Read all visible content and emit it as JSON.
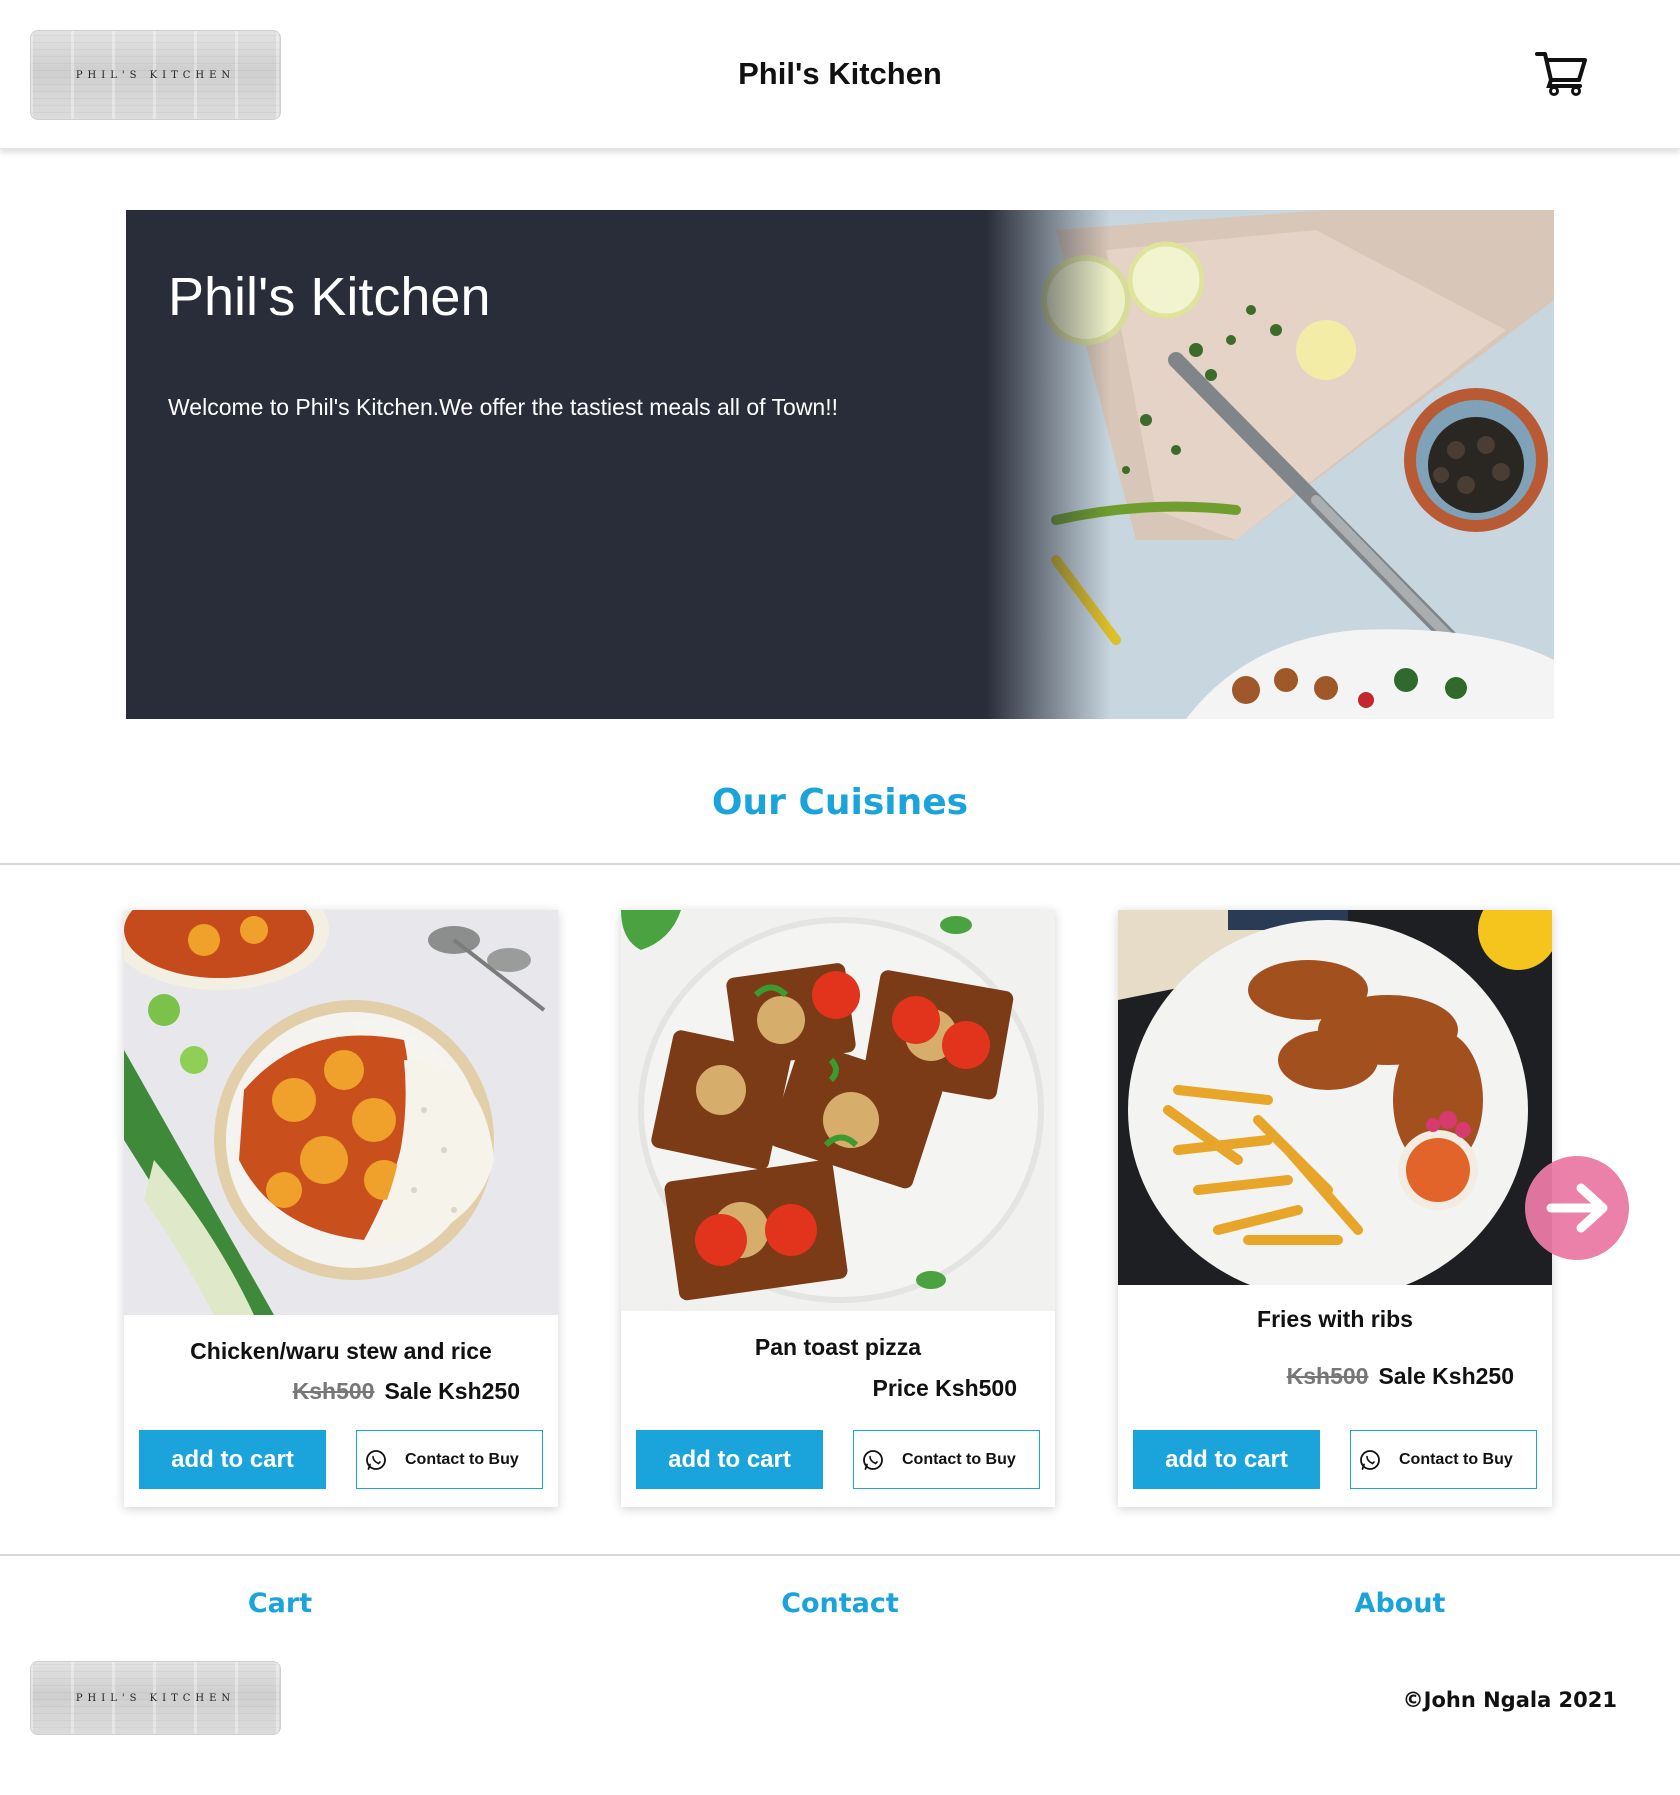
{
  "header": {
    "logo_text": "PHIL'S KITCHEN",
    "title": "Phil's Kitchen",
    "cart_icon": "shopping-cart-icon"
  },
  "hero": {
    "title": "Phil's Kitchen",
    "text": "Welcome to Phil's Kitchen.We offer the tastiest meals all of Town!!"
  },
  "section": {
    "title": "Our Cuisines"
  },
  "cards": [
    {
      "name": "Chicken/waru stew and rice",
      "old_price": "Ksh500",
      "price": "Sale Ksh250",
      "add_label": "add to cart",
      "contact_label": "Contact to Buy"
    },
    {
      "name": "Pan toast pizza",
      "old_price": "",
      "price": "Price Ksh500",
      "add_label": "add to cart",
      "contact_label": "Contact to Buy"
    },
    {
      "name": "Fries with ribs",
      "old_price": "Ksh500",
      "price": "Sale Ksh250",
      "add_label": "add to cart",
      "contact_label": "Contact to Buy"
    }
  ],
  "carousel": {
    "next_icon": "arrow-right-icon"
  },
  "footer": {
    "links": [
      "Cart",
      "Contact",
      "About"
    ],
    "logo_text": "PHIL'S KITCHEN",
    "copyright": "©John Ngala 2021"
  },
  "colors": {
    "accent": "#1ba3dc",
    "hero_bg": "#282d39",
    "arrow": "#ea7aa5"
  }
}
